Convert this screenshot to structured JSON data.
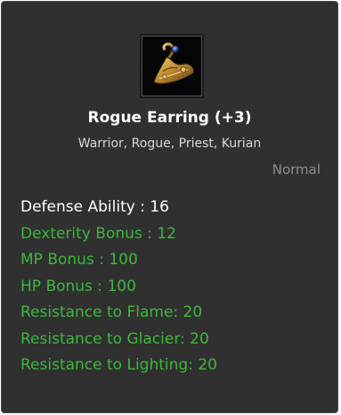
{
  "item": {
    "icon": "earring-icon",
    "name": "Rogue Earring (+3)",
    "classes": "Warrior, Rogue, Priest, Kurian",
    "rarity": "Normal"
  },
  "stats": {
    "defense": "Defense Ability : 16",
    "dexterity": "Dexterity Bonus : 12",
    "mp": "MP Bonus : 100",
    "hp": "HP Bonus : 100",
    "flame": "Resistance to Flame: 20",
    "glacier": "Resistance to Glacier: 20",
    "lighting": "Resistance to Lighting: 20"
  },
  "colors": {
    "panel": "#303030",
    "base_stat": "#ffffff",
    "bonus_stat": "#3db73d",
    "rarity": "#8e8e8e"
  }
}
